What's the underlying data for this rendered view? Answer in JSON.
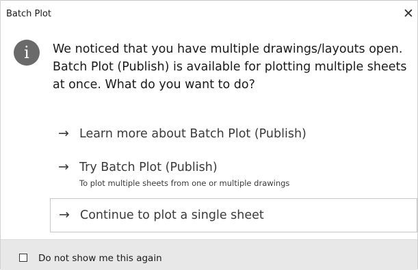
{
  "dialog": {
    "title": "Batch Plot",
    "close_glyph": "✕",
    "info_icon": "information-icon",
    "info_glyph": "i",
    "message": "We noticed that you have multiple drawings/layouts open. Batch Plot (Publish) is available for plotting multiple sheets at once. What do you want to do?"
  },
  "options": [
    {
      "arrow": "→",
      "label": "Learn more about Batch Plot (Publish)"
    },
    {
      "arrow": "→",
      "label": "Try Batch Plot (Publish)",
      "sublabel": "To plot multiple sheets from one or multiple drawings"
    },
    {
      "arrow": "→",
      "label": "Continue to plot a single sheet"
    }
  ],
  "footer": {
    "checkbox_label": "Do not show me this again",
    "checked": false
  },
  "colors": {
    "info_icon_bg": "#6a6a6a",
    "footer_bg": "#e8e8e8",
    "text": "#1a1a1a"
  }
}
